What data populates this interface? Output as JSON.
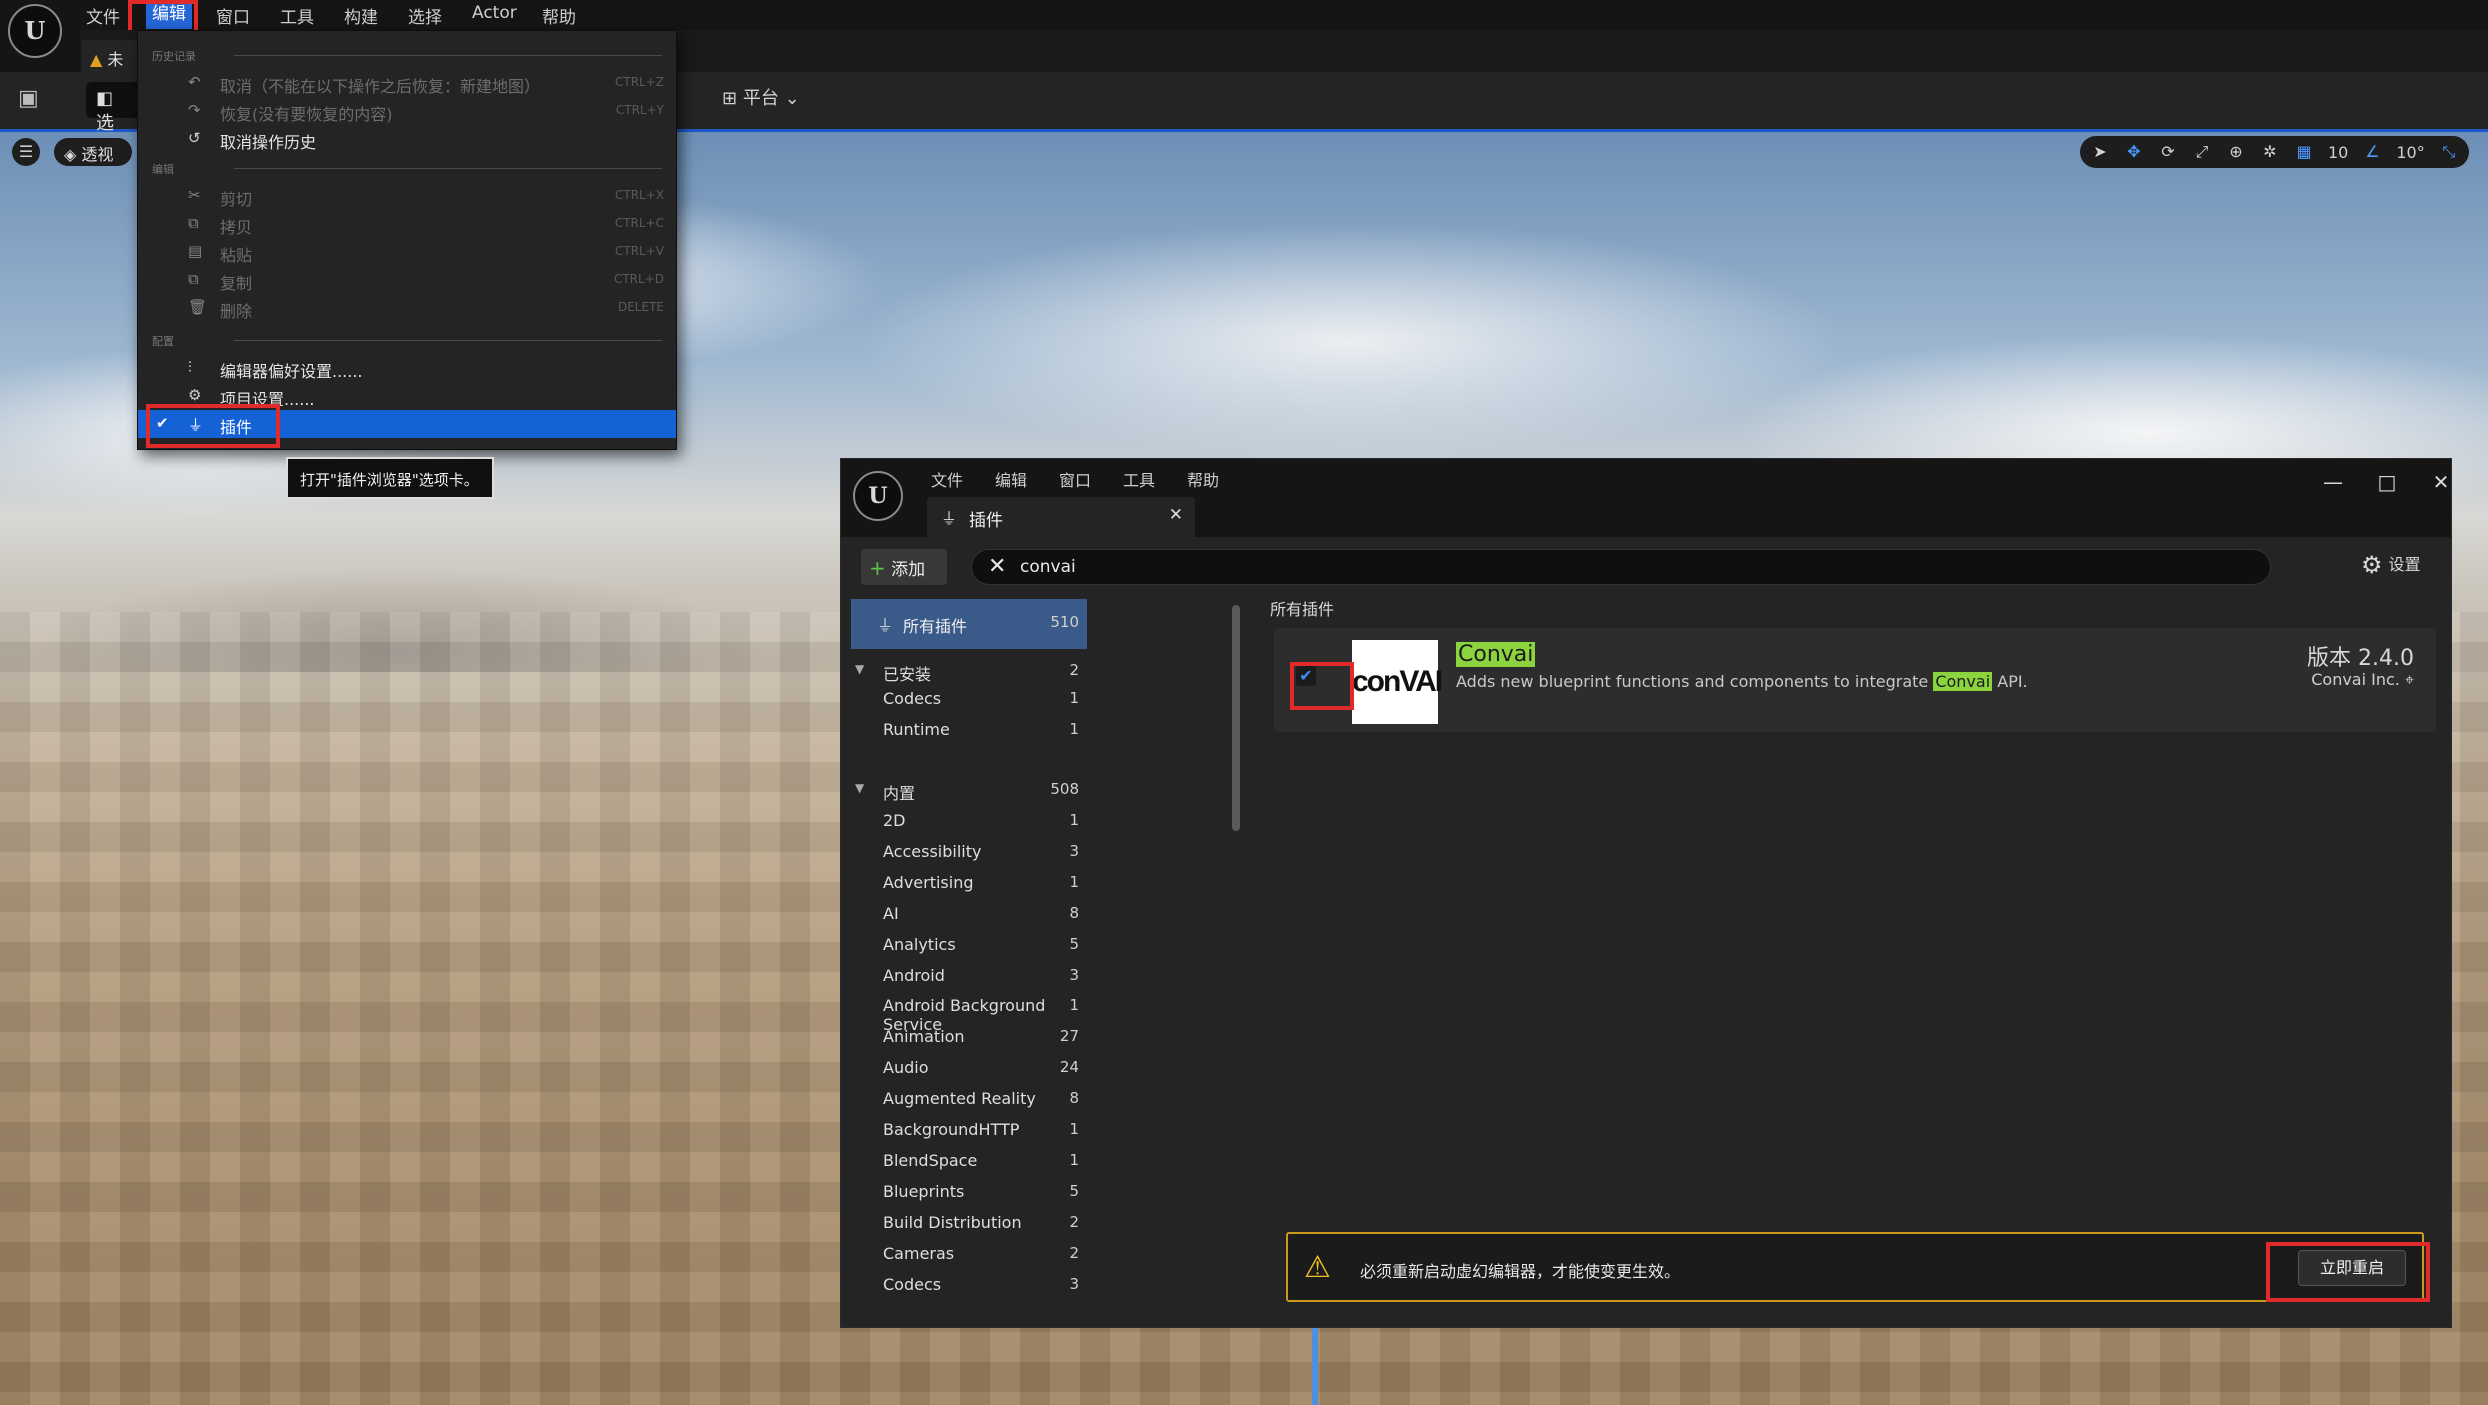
{
  "main_menu": {
    "items": [
      "文件",
      "编辑",
      "窗口",
      "工具",
      "构建",
      "选择",
      "Actor",
      "帮助"
    ]
  },
  "toolbar": {
    "level_tab": "未",
    "mode_label": "选",
    "platform_label": "平台"
  },
  "viewport": {
    "perspective_label": "透视",
    "grid_value": "10",
    "angle_value": "10°"
  },
  "edit_menu": {
    "section_history": "历史记录",
    "undo": "取消（不能在以下操作之后恢复：新建地图）",
    "undo_shortcut": "CTRL+Z",
    "redo": "恢复(没有要恢复的内容)",
    "redo_shortcut": "CTRL+Y",
    "undo_history": "取消操作历史",
    "section_edit": "编辑",
    "cut": "剪切",
    "cut_shortcut": "CTRL+X",
    "copy": "拷贝",
    "copy_shortcut": "CTRL+C",
    "paste": "粘贴",
    "paste_shortcut": "CTRL+V",
    "duplicate": "复制",
    "duplicate_shortcut": "CTRL+D",
    "delete": "删除",
    "delete_shortcut": "DELETE",
    "section_config": "配置",
    "editor_prefs": "编辑器偏好设置......",
    "project_settings": "项目设置......",
    "plugins": "插件",
    "tooltip": "打开\"插件浏览器\"选项卡。"
  },
  "plugins_window": {
    "menu": [
      "文件",
      "编辑",
      "窗口",
      "工具",
      "帮助"
    ],
    "tab_label": "插件",
    "add_label": "添加",
    "search_value": "convai",
    "settings_label": "设置",
    "list_title": "所有插件",
    "categories": {
      "all": {
        "label": "所有插件",
        "count": "510"
      },
      "installed": {
        "label": "已安装",
        "count": "2"
      },
      "installed_items": [
        {
          "label": "Codecs",
          "count": "1"
        },
        {
          "label": "Runtime",
          "count": "1"
        }
      ],
      "builtin": {
        "label": "内置",
        "count": "508"
      },
      "builtin_items": [
        {
          "label": "2D",
          "count": "1"
        },
        {
          "label": "Accessibility",
          "count": "3"
        },
        {
          "label": "Advertising",
          "count": "1"
        },
        {
          "label": "AI",
          "count": "8"
        },
        {
          "label": "Analytics",
          "count": "5"
        },
        {
          "label": "Android",
          "count": "3"
        },
        {
          "label": "Android Background Service",
          "count": "1"
        },
        {
          "label": "Animation",
          "count": "27"
        },
        {
          "label": "Audio",
          "count": "24"
        },
        {
          "label": "Augmented Reality",
          "count": "8"
        },
        {
          "label": "BackgroundHTTP",
          "count": "1"
        },
        {
          "label": "BlendSpace",
          "count": "1"
        },
        {
          "label": "Blueprints",
          "count": "5"
        },
        {
          "label": "Build Distribution",
          "count": "2"
        },
        {
          "label": "Cameras",
          "count": "2"
        },
        {
          "label": "Codecs",
          "count": "3"
        }
      ]
    },
    "plugin": {
      "logo_text": "conVAI",
      "name": "Convai",
      "desc_before": "Adds new blueprint functions and components to integrate ",
      "desc_highlight": "Convai",
      "desc_after": " API.",
      "version": "版本 2.4.0",
      "vendor": "Convai Inc.",
      "enabled": true
    },
    "restart_warning": "必须重新启动虚幻编辑器，才能使变更生效。",
    "restart_button": "立即重启"
  },
  "colors": {
    "accent_blue": "#1462d6",
    "highlight_red": "#e12a2a",
    "search_highlight": "#8bd43d",
    "warning_yellow": "#cc9a1a"
  }
}
